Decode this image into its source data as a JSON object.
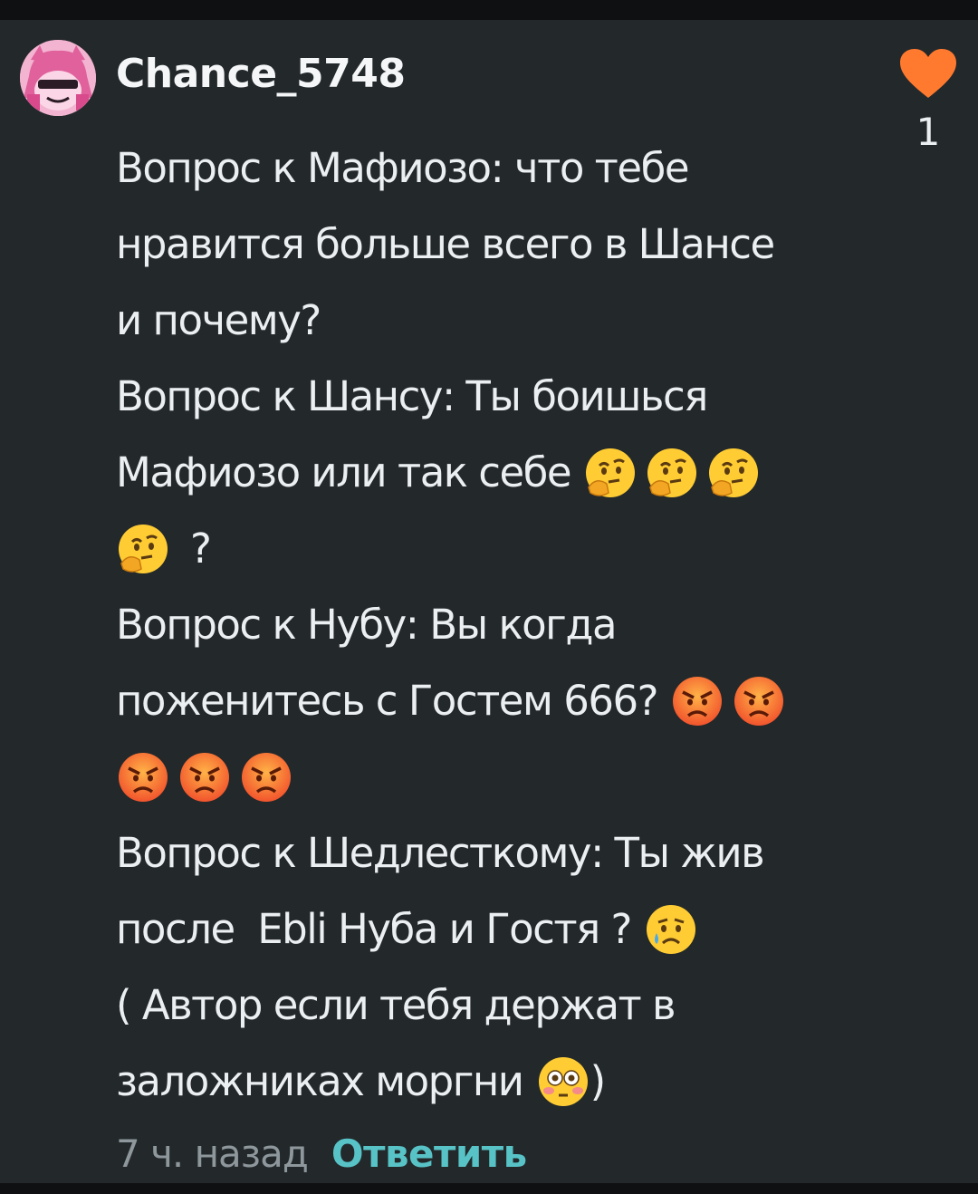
{
  "comment": {
    "username": "Chance_5748",
    "like_count": "1",
    "lines": [
      "Вопрос к Мафиозо: что тебе",
      "нравится больше всего в Шансе",
      "и почему?",
      "Вопрос к Шансу: Ты боишься",
      "Мафиозо или так себе",
      "?",
      "Вопрос к Нубу: Вы когда",
      "поженитесь с Гостем 666?",
      "",
      "Вопрос к Шедлесткому: Ты жив",
      "после  Ebli Нуба и Гостя ?",
      "( Автор если тебя держат в",
      "заложниках моргни",
      ")"
    ],
    "time": "7 ч. назад",
    "reply_label": "Ответить"
  },
  "icons": {
    "avatar": "avatar-image",
    "like": "heart-icon",
    "thinking": "thinking-face-emoji",
    "angry": "angry-face-emoji",
    "crying": "crying-face-emoji",
    "flushed": "flushed-face-emoji"
  },
  "colors": {
    "background": "#23282b",
    "text": "#eceff1",
    "heart": "#ff7a2e",
    "reply": "#58c3c6",
    "time": "#8e979c"
  }
}
